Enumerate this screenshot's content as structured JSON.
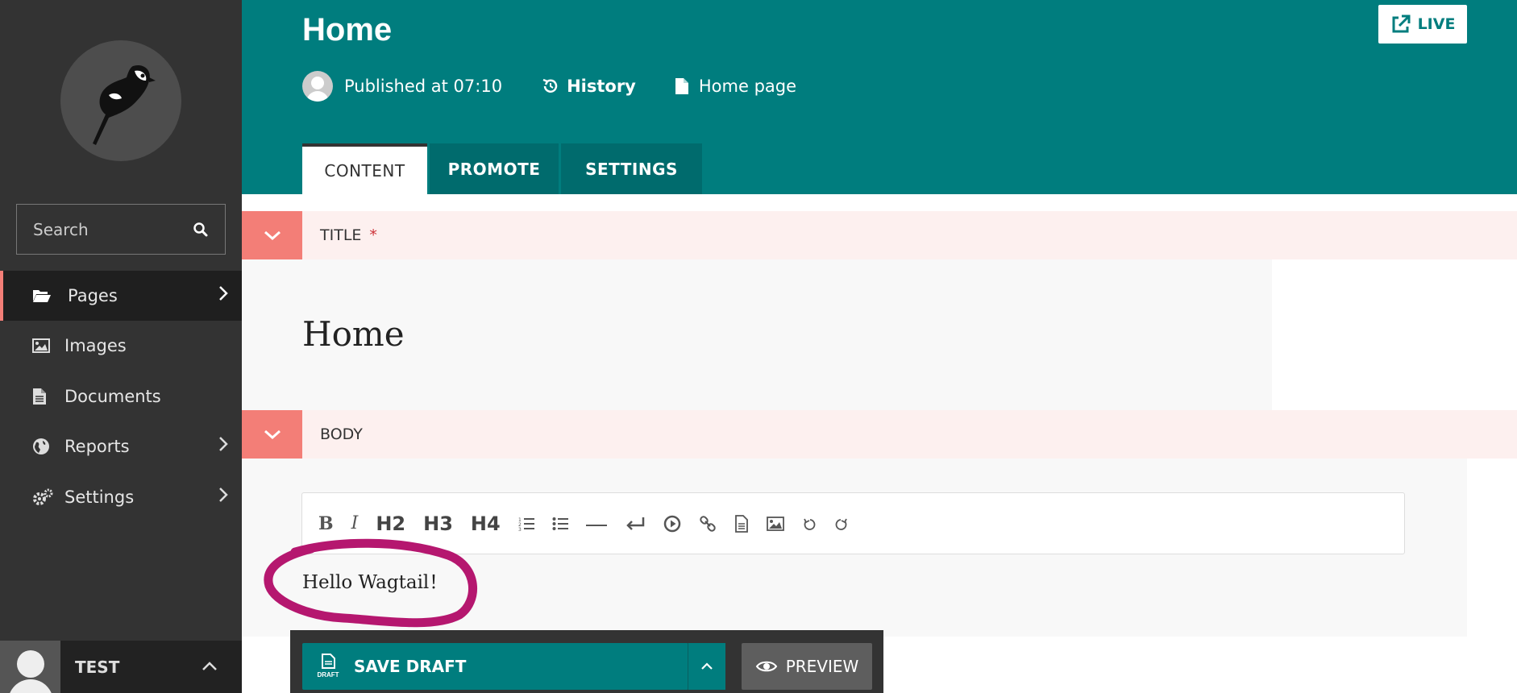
{
  "sidebar": {
    "search_placeholder": "Search",
    "items": [
      {
        "label": "Pages",
        "icon": "folder-open-icon",
        "active": true,
        "has_children": true
      },
      {
        "label": "Images",
        "icon": "image-icon",
        "active": false,
        "has_children": false
      },
      {
        "label": "Documents",
        "icon": "document-icon",
        "active": false,
        "has_children": false
      },
      {
        "label": "Reports",
        "icon": "globe-icon",
        "active": false,
        "has_children": true
      },
      {
        "label": "Settings",
        "icon": "cogs-icon",
        "active": false,
        "has_children": true
      }
    ],
    "account_name": "TEST"
  },
  "header": {
    "title": "Home",
    "published": "Published at 07:10",
    "history_label": "History",
    "page_type": "Home page",
    "live_label": "LIVE",
    "tabs": [
      {
        "label": "CONTENT",
        "active": true
      },
      {
        "label": "PROMOTE",
        "active": false
      },
      {
        "label": "SETTINGS",
        "active": false
      }
    ]
  },
  "panels": {
    "title_label": "TITLE",
    "required_mark": "*",
    "title_value": "Home",
    "body_label": "BODY"
  },
  "editor": {
    "toolbar": {
      "bold": "B",
      "italic": "I",
      "h2": "H2",
      "h3": "H3",
      "h4": "H4"
    },
    "content": "Hello Wagtail！"
  },
  "footer": {
    "save_label": "SAVE DRAFT",
    "save_icon_caption": "DRAFT",
    "preview_label": "PREVIEW"
  },
  "colors": {
    "primary": "#007d7e",
    "sidebar": "#333333",
    "accent": "#f37e77",
    "annotation": "#b5176f"
  }
}
